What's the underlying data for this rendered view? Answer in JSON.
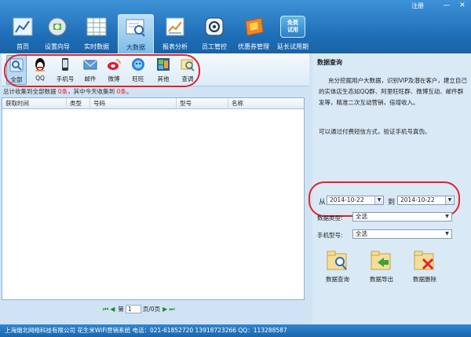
{
  "window": {
    "register_label": "注册",
    "min_glyph": "—",
    "close_glyph": "✕"
  },
  "nav": [
    {
      "label": "首页",
      "icon": "home-chart-icon"
    },
    {
      "label": "设置向导",
      "icon": "settings-wizard-icon"
    },
    {
      "label": "实时数据",
      "icon": "realtime-grid-icon"
    },
    {
      "label": "大数据",
      "icon": "big-data-search-icon"
    },
    {
      "label": "报表分析",
      "icon": "report-chart-icon"
    },
    {
      "label": "员工管控",
      "icon": "staff-control-icon"
    },
    {
      "label": "优惠券管理",
      "icon": "coupon-icon"
    },
    {
      "label": "延长试用期",
      "icon": "free-trial-icon"
    }
  ],
  "free_trial_badge": "免费试用",
  "categories": [
    {
      "label": "全部",
      "icon": "all-search-icon"
    },
    {
      "label": "QQ",
      "icon": "qq-penguin-icon"
    },
    {
      "label": "手机号",
      "icon": "mobile-phone-icon"
    },
    {
      "label": "邮件",
      "icon": "email-icon"
    },
    {
      "label": "微博",
      "icon": "weibo-icon"
    },
    {
      "label": "旺旺",
      "icon": "wangwang-icon"
    },
    {
      "label": "其他",
      "icon": "other-icon"
    },
    {
      "label": "查调",
      "icon": "query-icon"
    }
  ],
  "stat": {
    "prefix": "总计收集到全部数据 ",
    "total": "0条",
    "mid": "，其中今天收集到 ",
    "today": "0条",
    "suffix": "。"
  },
  "table": {
    "headers": [
      "获取时间",
      "类型",
      "号码",
      "型号",
      "名称"
    ]
  },
  "pager": {
    "first": "⏮",
    "prev": "◀",
    "page_prefix": "第",
    "page_value": "1",
    "page_suffix": "页/0页",
    "next": "▶",
    "last": "⏭"
  },
  "panel": {
    "title": "数据查询",
    "description": "充分挖掘用户大数据，识别VIP及潜在客户，建立自己的实体店生态如QQ群、阿里旺旺群、微博互动、邮件群发等，精准二次互动营销，倍增收入。",
    "note": "可以通过付费短信方式，验证手机号真伪。",
    "from_label": "从",
    "from_date": "2014-10-22",
    "to_label": "到",
    "to_date": "2014-10-22",
    "data_type_label": "数据类型:",
    "data_type_value": "全选",
    "phone_model_label": "手机型号:",
    "phone_model_value": "全选",
    "actions": [
      "数据查询",
      "数据导出",
      "数据删除"
    ]
  },
  "footer": "上海烟北网络科技有限公司  花生米WiFi营销系统   电话：021-61852720    13918723266   QQ：113288587",
  "colors": {
    "accent": "#1d6db6",
    "highlight": "#e3222a",
    "panel": "#d9e9f6"
  }
}
